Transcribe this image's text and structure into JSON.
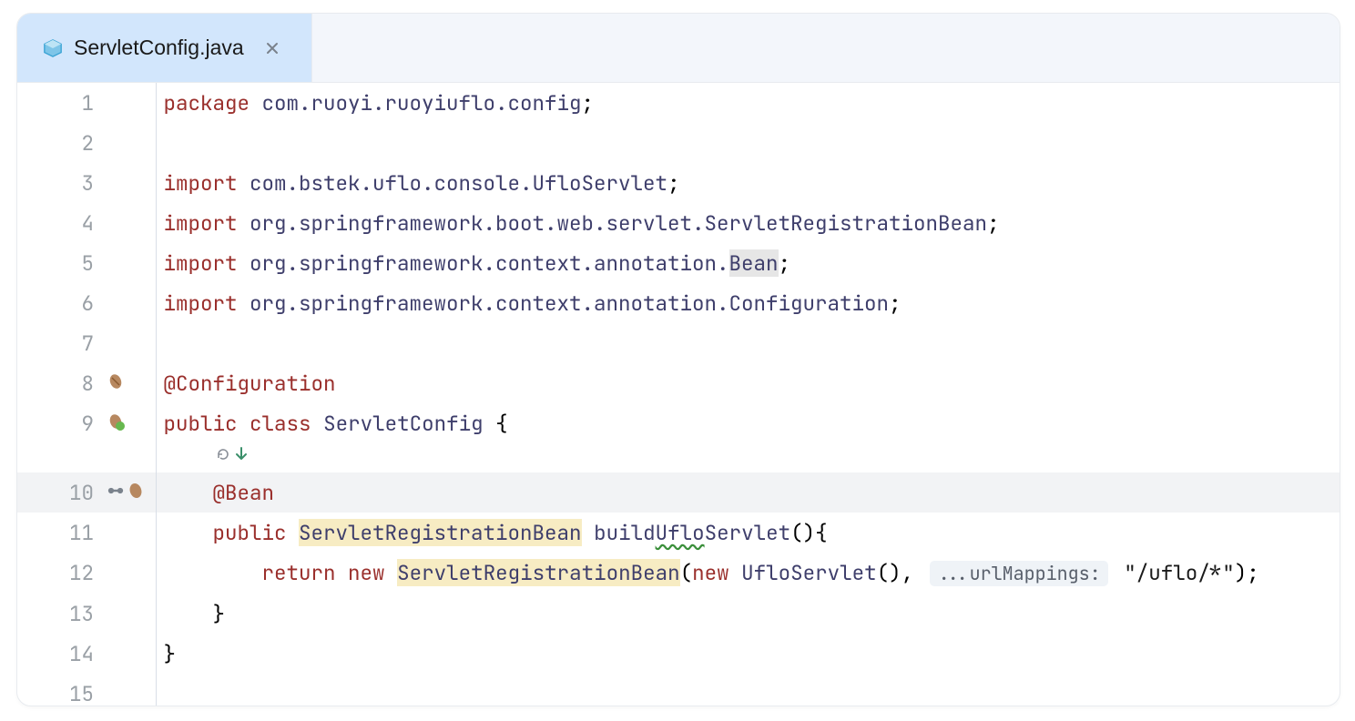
{
  "tab": {
    "filename": "ServletConfig.java",
    "icon": "java-class-icon",
    "close_icon": "close-icon"
  },
  "gutter_icons": {
    "8": "bean-class-icon",
    "9": "spring-bean-icon",
    "10": "spring-autowire-icon",
    "10b": "bean-method-icon"
  },
  "inlay": {
    "recursive_icon": "recursive-icon",
    "override_icon": "override-down-icon"
  },
  "code": {
    "1": {
      "kw": "package",
      "pkg": "com.ruoyi.ruoyiuflo.config",
      "semi": ";"
    },
    "3": {
      "kw": "import",
      "pkg": "com.bstek.uflo.console.",
      "cls": "UfloServlet",
      "semi": ";"
    },
    "4": {
      "kw": "import",
      "pkg": "org.springframework.boot.web.servlet.",
      "cls": "ServletRegistrationBean",
      "semi": ";"
    },
    "5": {
      "kw": "import",
      "pkg": "org.springframework.context.annotation.",
      "cls": "Bean",
      "semi": ";"
    },
    "6": {
      "kw": "import",
      "pkg": "org.springframework.context.annotation.",
      "cls": "Configuration",
      "semi": ";"
    },
    "8": {
      "ann": "@Configuration"
    },
    "9": {
      "kw1": "public",
      "kw2": "class",
      "cls": "ServletConfig",
      "open": "{"
    },
    "10": {
      "ann": "@Bean"
    },
    "11": {
      "kw": "public",
      "type": "ServletRegistrationBean",
      "meth": "build",
      "wavy": "Uflo",
      "meth2": "Servlet",
      "after": "(){"
    },
    "12": {
      "kw1": "return",
      "kw2": "new",
      "type": "ServletRegistrationBean",
      "open": "(",
      "kw3": "new",
      "type2": "UfloServlet",
      "call": "(), ",
      "hint": "...urlMappings:",
      "str": "\"/uflo/*\"",
      "close": ");"
    },
    "13": {
      "txt": "}"
    },
    "14": {
      "txt": "}"
    }
  },
  "line_numbers": [
    "1",
    "2",
    "3",
    "4",
    "5",
    "6",
    "7",
    "8",
    "9",
    "",
    "10",
    "11",
    "12",
    "13",
    "14",
    "15"
  ]
}
